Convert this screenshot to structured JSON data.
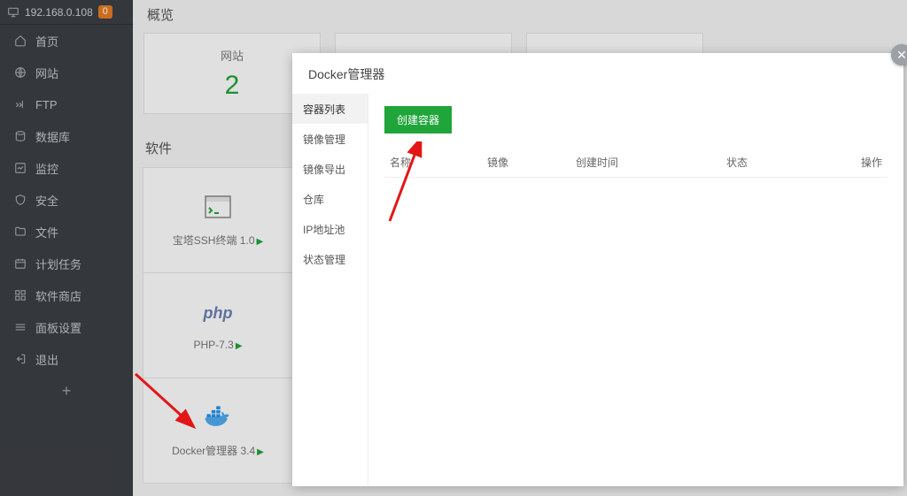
{
  "sidebar": {
    "ip": "192.168.0.108",
    "badge": "0",
    "items": [
      {
        "label": "首页"
      },
      {
        "label": "网站"
      },
      {
        "label": "FTP"
      },
      {
        "label": "数据库"
      },
      {
        "label": "监控"
      },
      {
        "label": "安全"
      },
      {
        "label": "文件"
      },
      {
        "label": "计划任务"
      },
      {
        "label": "软件商店"
      },
      {
        "label": "面板设置"
      },
      {
        "label": "退出"
      }
    ]
  },
  "overview": {
    "title": "概览",
    "card1_label": "网站",
    "card1_value": "2"
  },
  "software": {
    "title": "软件",
    "items": [
      {
        "label": "宝塔SSH终端 1.0"
      },
      {
        "label": "PHP-7.3"
      },
      {
        "label": "Docker管理器 3.4"
      }
    ]
  },
  "modal": {
    "title": "Docker管理器",
    "tabs": [
      {
        "label": "容器列表"
      },
      {
        "label": "镜像管理"
      },
      {
        "label": "镜像导出"
      },
      {
        "label": "仓库"
      },
      {
        "label": "IP地址池"
      },
      {
        "label": "状态管理"
      }
    ],
    "create_button": "创建容器",
    "columns": {
      "name": "名称",
      "image": "镜像",
      "created": "创建时间",
      "status": "状态",
      "action": "操作"
    }
  }
}
